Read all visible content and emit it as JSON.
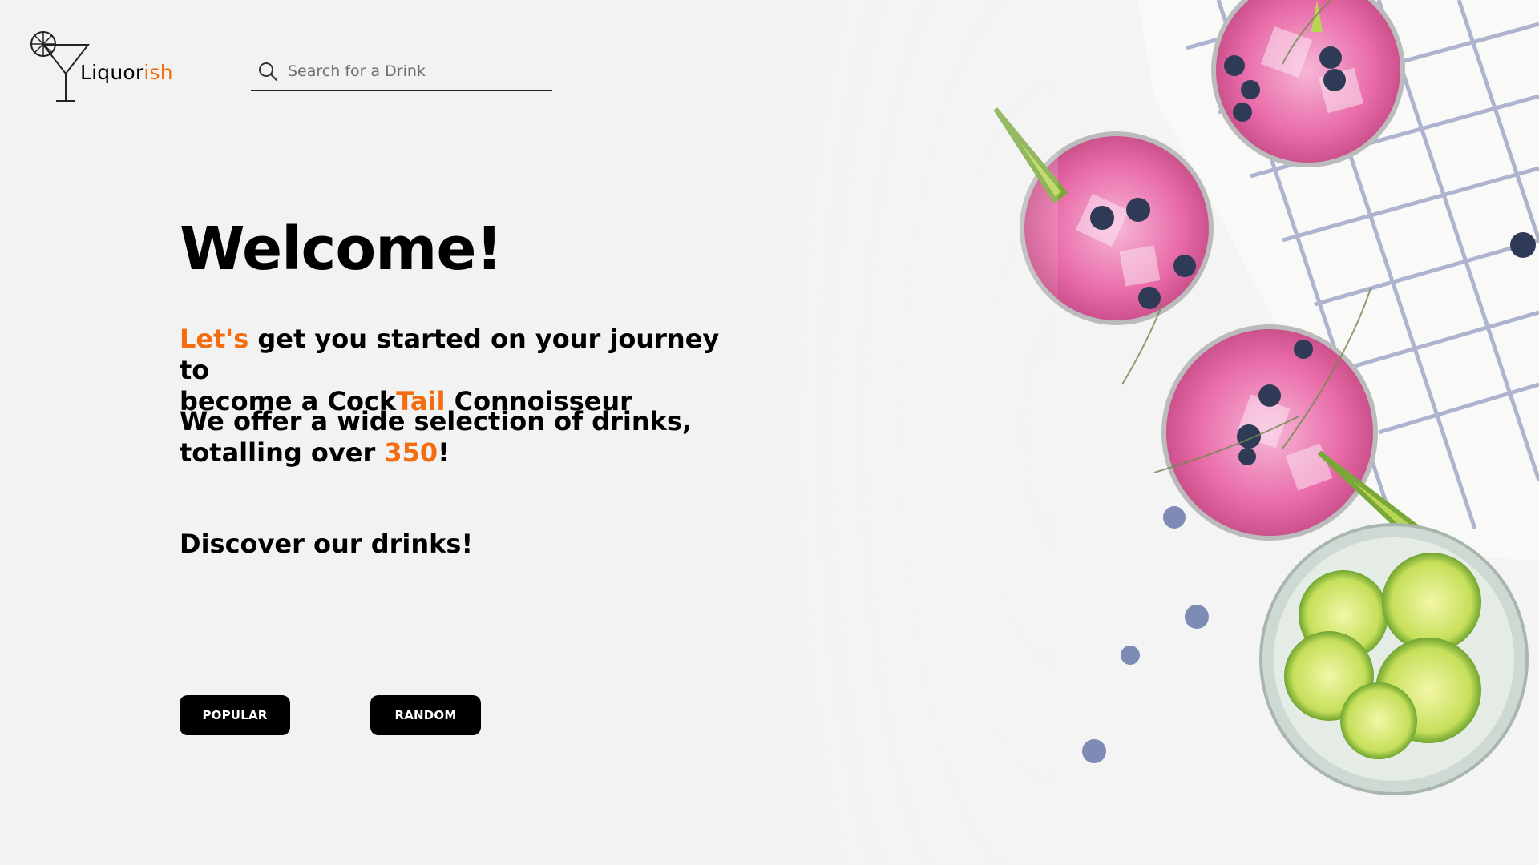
{
  "brand": {
    "name_part1": "Liquor",
    "name_part2": "ish"
  },
  "search": {
    "placeholder": "Search for a Drink"
  },
  "hero": {
    "title": "Welcome!",
    "line1_accent": "Let's",
    "line1_rest": " get you started on your journey to",
    "line2_start": "become a Cock",
    "line2_accent": "Tail",
    "line2_end": " Connoisseur",
    "line3": "We offer a wide selection of drinks,",
    "line4_start": "totalling over ",
    "line4_accent": "350",
    "line4_end": "!",
    "discover": "Discover our drinks!"
  },
  "buttons": {
    "popular": "POPULAR",
    "random": "RANDOM"
  },
  "colors": {
    "accent": "#f36c0f",
    "background": "#f1f2f1",
    "button": "#000000"
  },
  "icons": {
    "logo": "martini-glass-icon",
    "search": "search-icon",
    "menu": "hamburger-menu-icon"
  }
}
